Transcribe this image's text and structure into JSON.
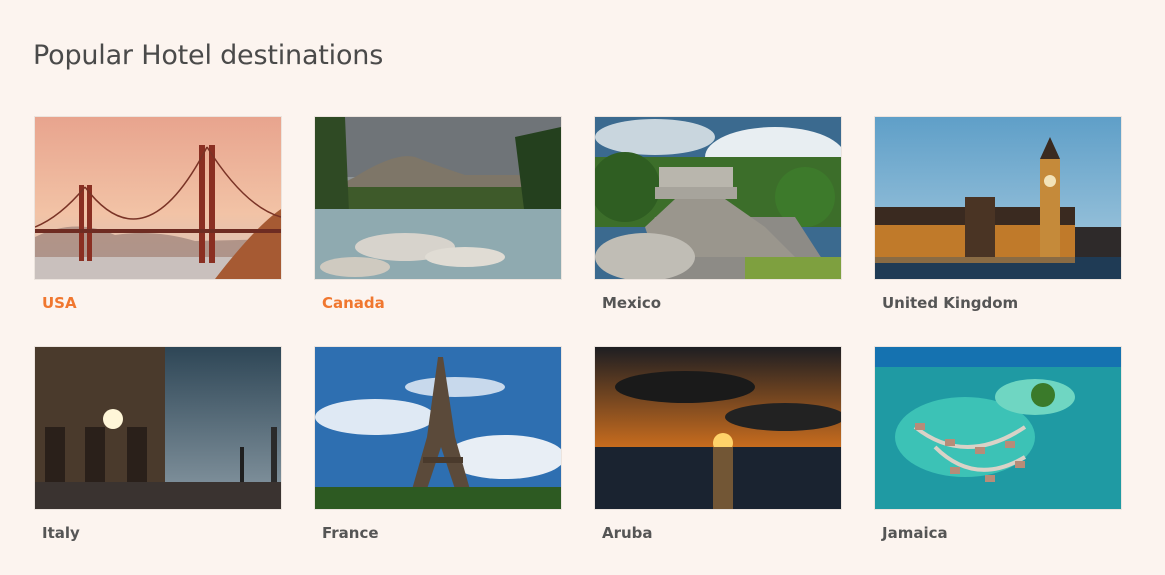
{
  "page": {
    "title": "Popular Hotel destinations"
  },
  "destinations": [
    {
      "name": "USA",
      "image": "golden-gate-bridge",
      "highlight": true
    },
    {
      "name": "Canada",
      "image": "mountain-river",
      "highlight": true
    },
    {
      "name": "Mexico",
      "image": "mayan-pyramid",
      "highlight": false
    },
    {
      "name": "United Kingdom",
      "image": "big-ben",
      "highlight": false
    },
    {
      "name": "Italy",
      "image": "venice-doge-palace",
      "highlight": false
    },
    {
      "name": "France",
      "image": "eiffel-tower",
      "highlight": false
    },
    {
      "name": "Aruba",
      "image": "sunset-sea",
      "highlight": false
    },
    {
      "name": "Jamaica",
      "image": "overwater-bungalows",
      "highlight": false
    }
  ],
  "colors": {
    "background": "#fcf4ef",
    "accent": "#f0772f",
    "label": "#555555"
  }
}
